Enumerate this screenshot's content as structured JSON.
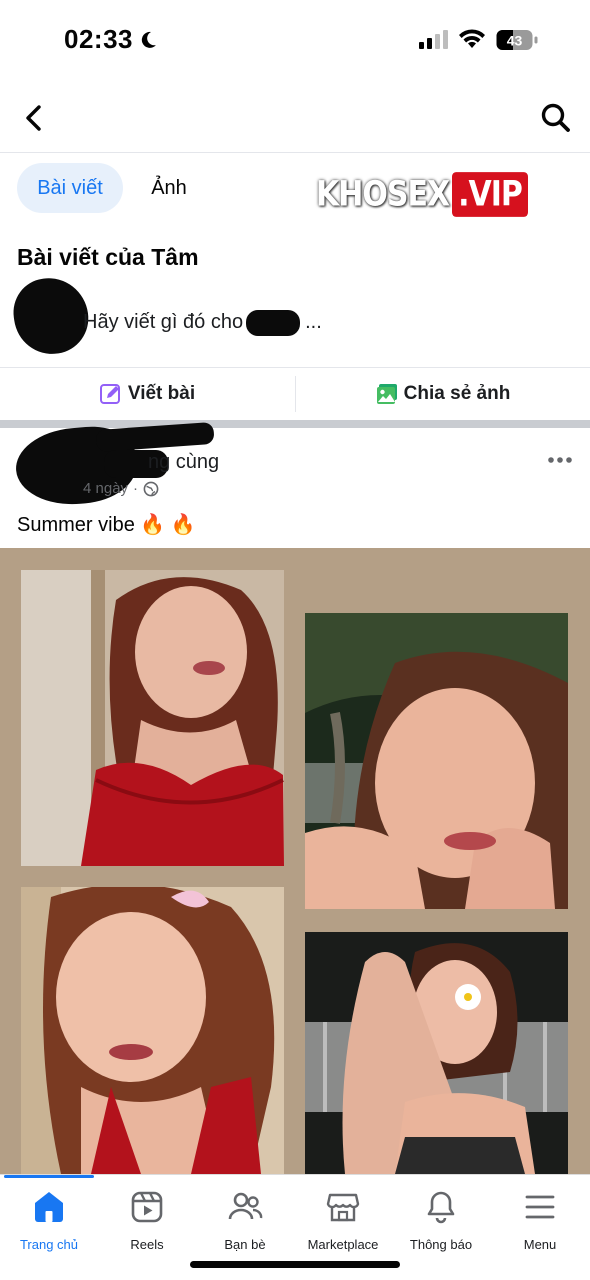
{
  "status_bar": {
    "time": "02:33",
    "battery": "43"
  },
  "tabs": [
    {
      "label": "Bài viết"
    },
    {
      "label": "Ảnh"
    }
  ],
  "watermark": {
    "part1": "KHOSEX",
    "part2": ".VIP"
  },
  "section": {
    "title": "Bài viết của Tâm"
  },
  "composer": {
    "placeholder_prefix": "Hãy viết gì đó cho",
    "placeholder_suffix": "..."
  },
  "actions": {
    "write": "Viết bài",
    "share_photo": "Chia sẻ ảnh"
  },
  "post": {
    "author_tail": "ng cùng",
    "time": "4 ngày",
    "separator": "·",
    "caption": "Summer vibe 🔥 🔥",
    "photo_count": 4
  },
  "bottom_nav": [
    {
      "label": "Trang chủ",
      "icon": "home-icon"
    },
    {
      "label": "Reels",
      "icon": "reels-icon"
    },
    {
      "label": "Bạn bè",
      "icon": "friends-icon"
    },
    {
      "label": "Marketplace",
      "icon": "marketplace-icon"
    },
    {
      "label": "Thông báo",
      "icon": "bell-icon"
    },
    {
      "label": "Menu",
      "icon": "menu-icon"
    }
  ],
  "colors": {
    "accent": "#1877f2",
    "tab_active_bg": "#e7f0fb",
    "photo_bg": "#b49f86",
    "separator": "#c9ccd1",
    "watermark_red": "#d6111e"
  }
}
